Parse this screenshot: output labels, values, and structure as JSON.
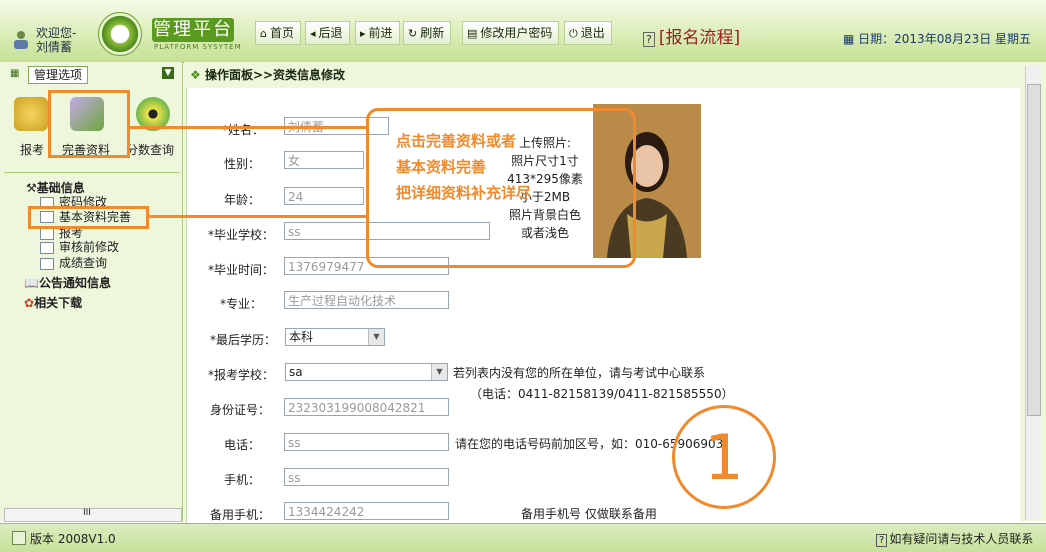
{
  "header": {
    "welcome_line": "欢迎您-",
    "user_name": "刘倩蓄",
    "logo_title": "管理平台",
    "logo_subtitle": "PLATFORM SYSYTEM",
    "nav": {
      "home": "首页",
      "back": "后退",
      "forward": "前进",
      "refresh": "刷新",
      "change_password": "修改用户密码",
      "logout": "退出"
    },
    "process_link": "[报名流程]",
    "date": "日期：2013年08月23日 星期五"
  },
  "sidebar": {
    "title": "管理选项",
    "big_icons": [
      {
        "label": "报考"
      },
      {
        "label": "完善资料"
      },
      {
        "label": "分数查询"
      }
    ],
    "tree": {
      "basic_info": "基础信息",
      "items": [
        "密码修改",
        "基本资料完善",
        "报考",
        "审核前修改",
        "成绩查询"
      ],
      "notice": "公告通知信息",
      "downloads": "相关下载"
    },
    "scroll_mark": "III"
  },
  "main": {
    "breadcrumb": "操作面板>>资类信息修改",
    "form": {
      "name": {
        "label": "*姓名：",
        "value": "刘倩蓄"
      },
      "gender": {
        "label": "性别：",
        "value": "女"
      },
      "age": {
        "label": "年龄：",
        "value": "24"
      },
      "school": {
        "label": "*毕业学校：",
        "value": "ss"
      },
      "grad_time": {
        "label": "*毕业时间：",
        "value": "1376979477"
      },
      "major": {
        "label": "*专业：",
        "value": "生产过程自动化技术"
      },
      "education": {
        "label": "*最后学历：",
        "value": "本科"
      },
      "apply_school": {
        "label": "*报考学校：",
        "value": "sa"
      },
      "id_number": {
        "label": "身份证号：",
        "value": "232303199008042821"
      },
      "phone": {
        "label": "电话：",
        "value": "ss"
      },
      "mobile": {
        "label": "手机：",
        "value": "ss"
      },
      "backup_mobile": {
        "label": "备用手机：",
        "value": "1334424242"
      }
    },
    "notes": {
      "school_note_1": "若列表内没有您的所在单位，请与考试中心联系",
      "school_note_2": "（电话：0411-82158139/0411-821585550）",
      "phone_note": "请在您的电话号码前加区号，如：010-65906903",
      "backup_note": "备用手机号 仅做联系备用"
    },
    "photo_info": [
      "上传照片:",
      "照片尺寸1寸",
      "413*295像素",
      "小于2MB",
      "照片背景白色",
      "或者浅色"
    ]
  },
  "annotations": {
    "callout_lines": [
      "点击完善资料或者",
      "基本资料完善",
      "把详细资料补充详尽"
    ],
    "step_number": "1",
    "color": "#f08a2c"
  },
  "footer": {
    "version": "版本 2008V1.0",
    "help": "如有疑问请与技术人员联系"
  }
}
